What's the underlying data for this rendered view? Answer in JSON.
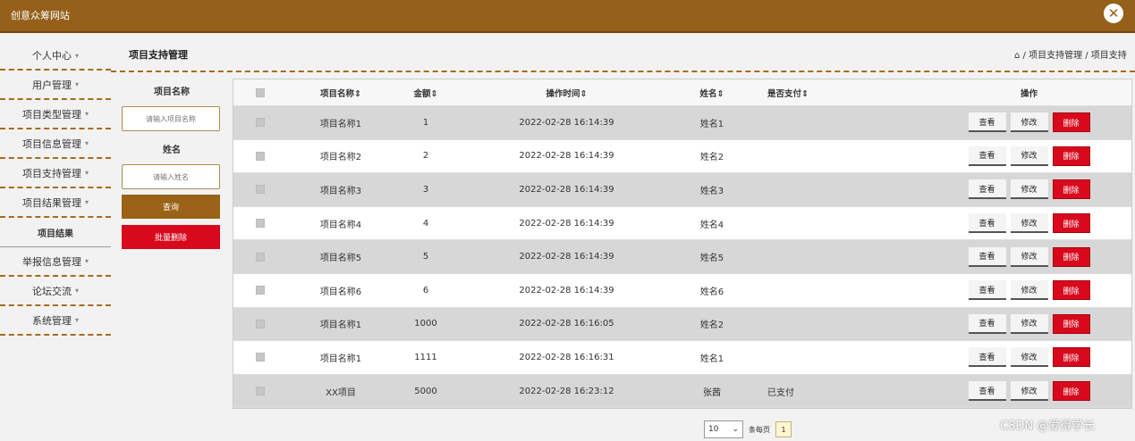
{
  "app": {
    "title": "创意众筹网站",
    "close_icon": "close-icon"
  },
  "sidebar": {
    "items": [
      {
        "label": "个人中心"
      },
      {
        "label": "用户管理"
      },
      {
        "label": "项目类型管理"
      },
      {
        "label": "项目信息管理"
      },
      {
        "label": "项目支持管理"
      },
      {
        "label": "项目结果管理"
      },
      {
        "label": "项目结果"
      },
      {
        "label": "举报信息管理"
      },
      {
        "label": "论坛交流"
      },
      {
        "label": "系统管理"
      }
    ],
    "caret": "▾"
  },
  "page": {
    "title": "项目支持管理",
    "breadcrumb": "⌂ / 项目支持管理 / 项目支持"
  },
  "filter": {
    "name_label": "项目名称",
    "name_placeholder": "请输入项目名称",
    "person_label": "姓名",
    "person_placeholder": "请输入姓名",
    "query_button": "查询",
    "batch_delete_button": "批量删除"
  },
  "table": {
    "headers": {
      "name": "项目名称⇕",
      "amount": "金额⇕",
      "time": "操作时间⇕",
      "person": "姓名⇕",
      "paid": "是否支付⇕",
      "ops": "操作"
    },
    "actions": {
      "view": "查看",
      "edit": "修改",
      "delete": "删除"
    },
    "rows": [
      {
        "name": "项目名称1",
        "amount": "1",
        "time": "2022-02-28 16:14:39",
        "person": "姓名1",
        "paid": ""
      },
      {
        "name": "项目名称2",
        "amount": "2",
        "time": "2022-02-28 16:14:39",
        "person": "姓名2",
        "paid": ""
      },
      {
        "name": "项目名称3",
        "amount": "3",
        "time": "2022-02-28 16:14:39",
        "person": "姓名3",
        "paid": ""
      },
      {
        "name": "项目名称4",
        "amount": "4",
        "time": "2022-02-28 16:14:39",
        "person": "姓名4",
        "paid": ""
      },
      {
        "name": "项目名称5",
        "amount": "5",
        "time": "2022-02-28 16:14:39",
        "person": "姓名5",
        "paid": ""
      },
      {
        "name": "项目名称6",
        "amount": "6",
        "time": "2022-02-28 16:14:39",
        "person": "姓名6",
        "paid": ""
      },
      {
        "name": "项目名称1",
        "amount": "1000",
        "time": "2022-02-28 16:16:05",
        "person": "姓名2",
        "paid": ""
      },
      {
        "name": "项目名称1",
        "amount": "1111",
        "time": "2022-02-28 16:16:31",
        "person": "姓名1",
        "paid": ""
      },
      {
        "name": "XX项目",
        "amount": "5000",
        "time": "2022-02-28 16:23:12",
        "person": "张茜",
        "paid": "已支付"
      }
    ]
  },
  "pager": {
    "page_size": "10",
    "per_page_label": "条每页",
    "current_page": "1"
  },
  "watermark": "CSDN @爱得学长",
  "colors": {
    "brand": "#95601a",
    "danger": "#d8091c"
  }
}
